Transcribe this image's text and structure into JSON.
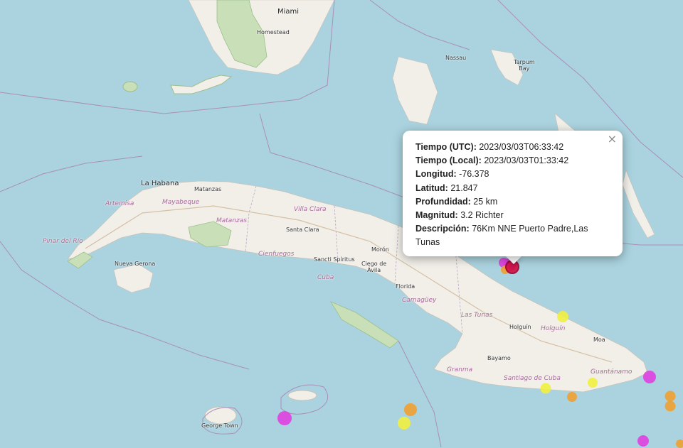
{
  "places": {
    "miami": "Miami",
    "homestead": "Homestead",
    "nassau": "Nassau",
    "tarpum_bay": "Tarpum\nBay",
    "la_habana": "La Habana",
    "matanzas_city": "Matanzas",
    "artemisa": "Artemisa",
    "mayabeque": "Mayabeque",
    "matanzas_prov": "Matanzas",
    "villa_clara": "Villa Clara",
    "santa_clara": "Santa Clara",
    "pinar_del_rio": "Pinar del Río",
    "nueva_gerona": "Nueva Gerona",
    "cienfuegos": "Cienfuegos",
    "sancti_spiritus": "Sancti Spíritus",
    "moron": "Morón",
    "ciego_de_avila": "Ciego de\nÁvila",
    "cuba": "Cuba",
    "florida": "Florida",
    "camaguey": "Camagüey",
    "las_tunas": "Las Tunas",
    "holguin_city": "Holguín",
    "holguin_prov": "Holguín",
    "moa": "Moa",
    "bayamo": "Bayamo",
    "granma": "Granma",
    "santiago": "Santiago de Cuba",
    "guantanamo": "Guantánamo",
    "george_town": "George Town"
  },
  "popup": {
    "close": "×",
    "tiempo_utc_label": "Tiempo (UTC):",
    "tiempo_utc_value": "2023/03/03T06:33:42",
    "tiempo_local_label": "Tiempo (Local):",
    "tiempo_local_value": "2023/03/03T01:33:42",
    "longitud_label": "Longitud:",
    "longitud_value": "-76.378",
    "latitud_label": "Latitud:",
    "latitud_value": "21.847",
    "profundidad_label": "Profundidad:",
    "profundidad_value": "25 km",
    "magnitud_label": "Magnitud:",
    "magnitud_value": "3.2 Richter",
    "descripcion_label": "Descripción:",
    "descripcion_value": "76Km NNE Puerto Padre,Las Tunas"
  },
  "colors": {
    "sea": "#aad3df",
    "land": "#f2efe9",
    "park": "#c8dfb8",
    "boundary": "#a98fb8",
    "marker_magenta": "#e040e0",
    "marker_yellow": "#f0f040",
    "marker_orange": "#f0a030",
    "marker_selected": "#d01040"
  }
}
